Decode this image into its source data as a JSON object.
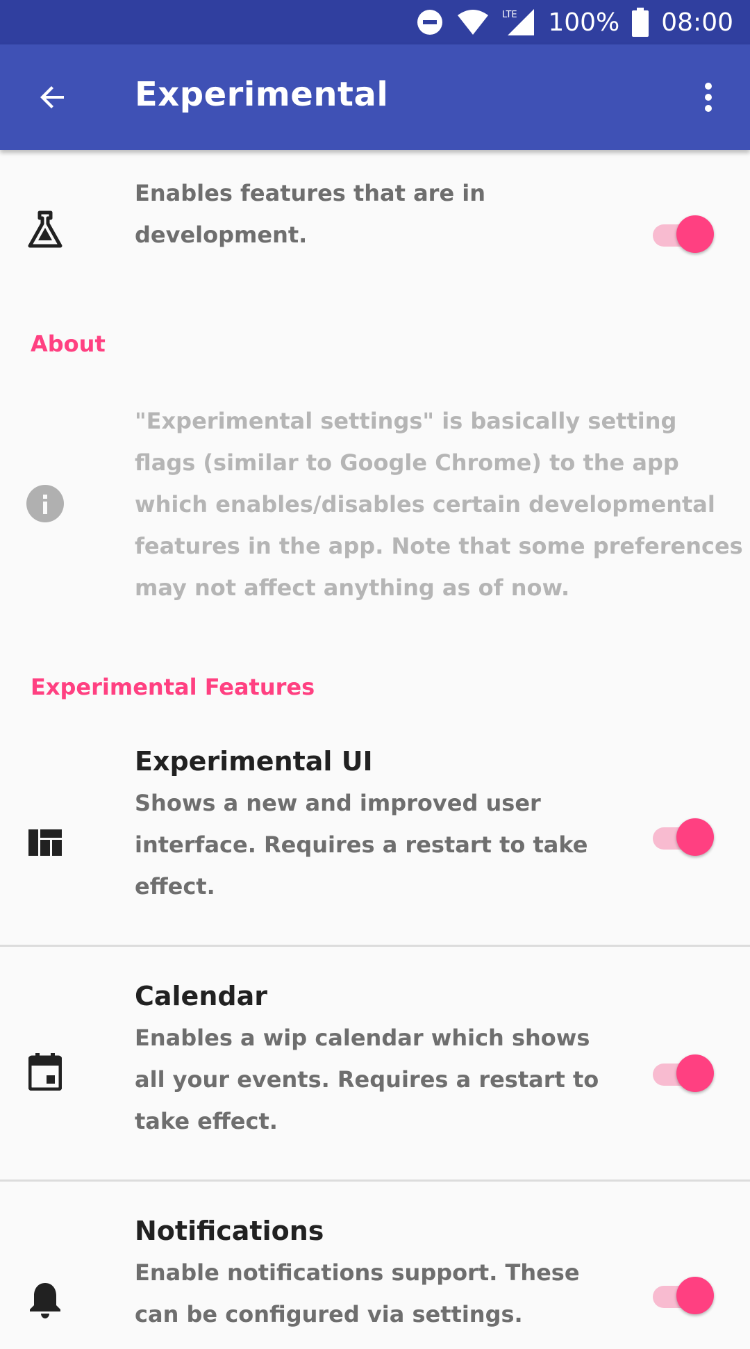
{
  "status_bar": {
    "battery": "100%",
    "time": "08:00",
    "network": "LTE",
    "icons": [
      "do-not-disturb-icon",
      "wifi-icon",
      "lte-signal-icon",
      "battery-icon"
    ]
  },
  "app_bar": {
    "title": "Experimental",
    "back_icon": "arrow-back-icon",
    "overflow_icon": "more-vert-icon"
  },
  "master": {
    "icon": "flask-icon",
    "line1": "Enables features that are in",
    "line2": "development.",
    "enabled": true
  },
  "about": {
    "header": "About",
    "icon": "info-icon",
    "lines": [
      "\"Experimental settings\" is basically setting",
      "flags (similar to Google Chrome) to the app",
      "which enables/disables certain developmental",
      "features in the app. Note that some preferences",
      "may not affect anything as of now."
    ]
  },
  "features": {
    "header": "Experimental Features",
    "items": [
      {
        "icon": "dashboard-icon",
        "title": "Experimental UI",
        "lines": [
          "Shows a new and improved user",
          "interface. Requires a restart to take",
          "effect."
        ],
        "enabled": true
      },
      {
        "icon": "calendar-icon",
        "title": "Calendar",
        "lines": [
          "Enables a wip calendar which shows",
          "all your events. Requires a restart to",
          "take effect."
        ],
        "enabled": true
      },
      {
        "icon": "bell-icon",
        "title": "Notifications",
        "lines": [
          "Enable notifications support. These",
          "can be configured via settings."
        ],
        "enabled": true
      }
    ]
  },
  "colors": {
    "status_bar": "#303f9f",
    "app_bar": "#3f51b5",
    "accent": "#ff4081",
    "accent_track": "#f8bbd0",
    "background": "#fafafa"
  }
}
